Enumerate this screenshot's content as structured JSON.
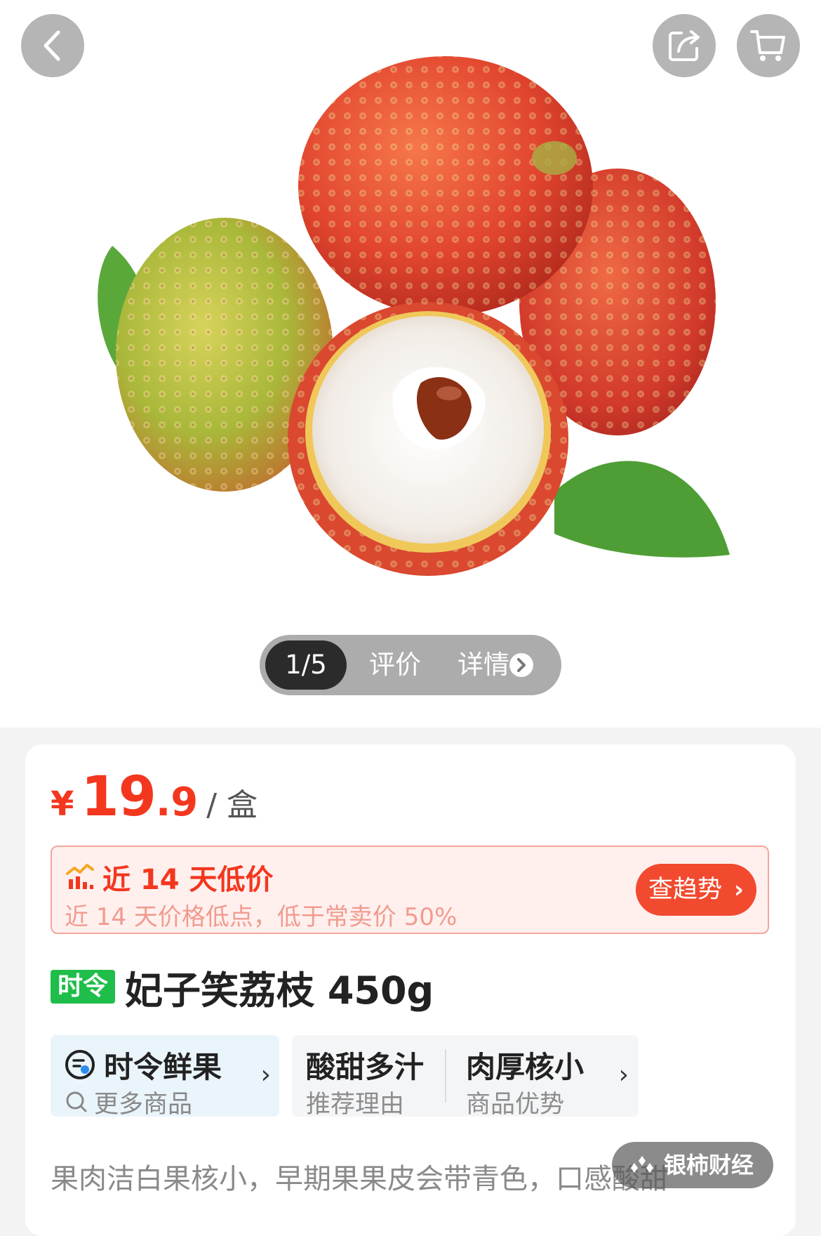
{
  "gallery": {
    "counter": "1/5",
    "tab_reviews": "评价",
    "tab_details": "详情"
  },
  "price": {
    "currency": "¥",
    "integer": "19",
    "decimal": ".9",
    "unit": "/ 盒"
  },
  "low_price": {
    "title": "近 14 天低价",
    "subtitle": "近 14 天价格低点，低于常卖价 50%",
    "button": "查趋势"
  },
  "product": {
    "tag": "时令",
    "title": "妃子笑荔枝 450g"
  },
  "features": {
    "category": {
      "title": "时令鲜果",
      "sub": "更多商品"
    },
    "items": [
      {
        "title": "酸甜多汁",
        "sub": "推荐理由"
      },
      {
        "title": "肉厚核小",
        "sub": "商品优势"
      }
    ]
  },
  "description": "果肉洁白果核小，早期果果皮会带青色，口感酸甜",
  "watermark": "银柿财经",
  "colors": {
    "price_red": "#f3371f",
    "tag_green": "#1fbe4a",
    "trend_button": "#f24a2e"
  }
}
